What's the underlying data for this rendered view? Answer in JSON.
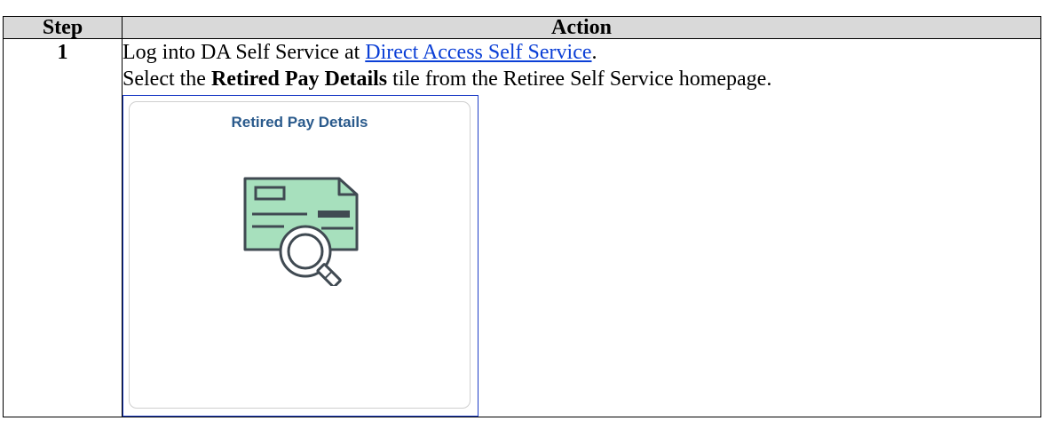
{
  "table": {
    "headers": {
      "step": "Step",
      "action": "Action"
    },
    "rows": [
      {
        "step": "1",
        "line1": {
          "prefix": "Log into DA Self Service at ",
          "link": "Direct Access Self Service",
          "suffix": "."
        },
        "line2": {
          "prefix": "Select the ",
          "bold": "Retired Pay Details",
          "suffix": " tile from the Retiree Self Service homepage."
        },
        "tile": {
          "title": "Retired Pay Details",
          "icon": "check-search-icon"
        }
      }
    ]
  },
  "colors": {
    "link": "#0b3fd6",
    "tile_title": "#2a5a8c",
    "check_fill": "#a7e0bd",
    "icon_stroke": "#404a52",
    "header_bg": "#d9d9d9",
    "frame_border": "#1f3fc7"
  }
}
